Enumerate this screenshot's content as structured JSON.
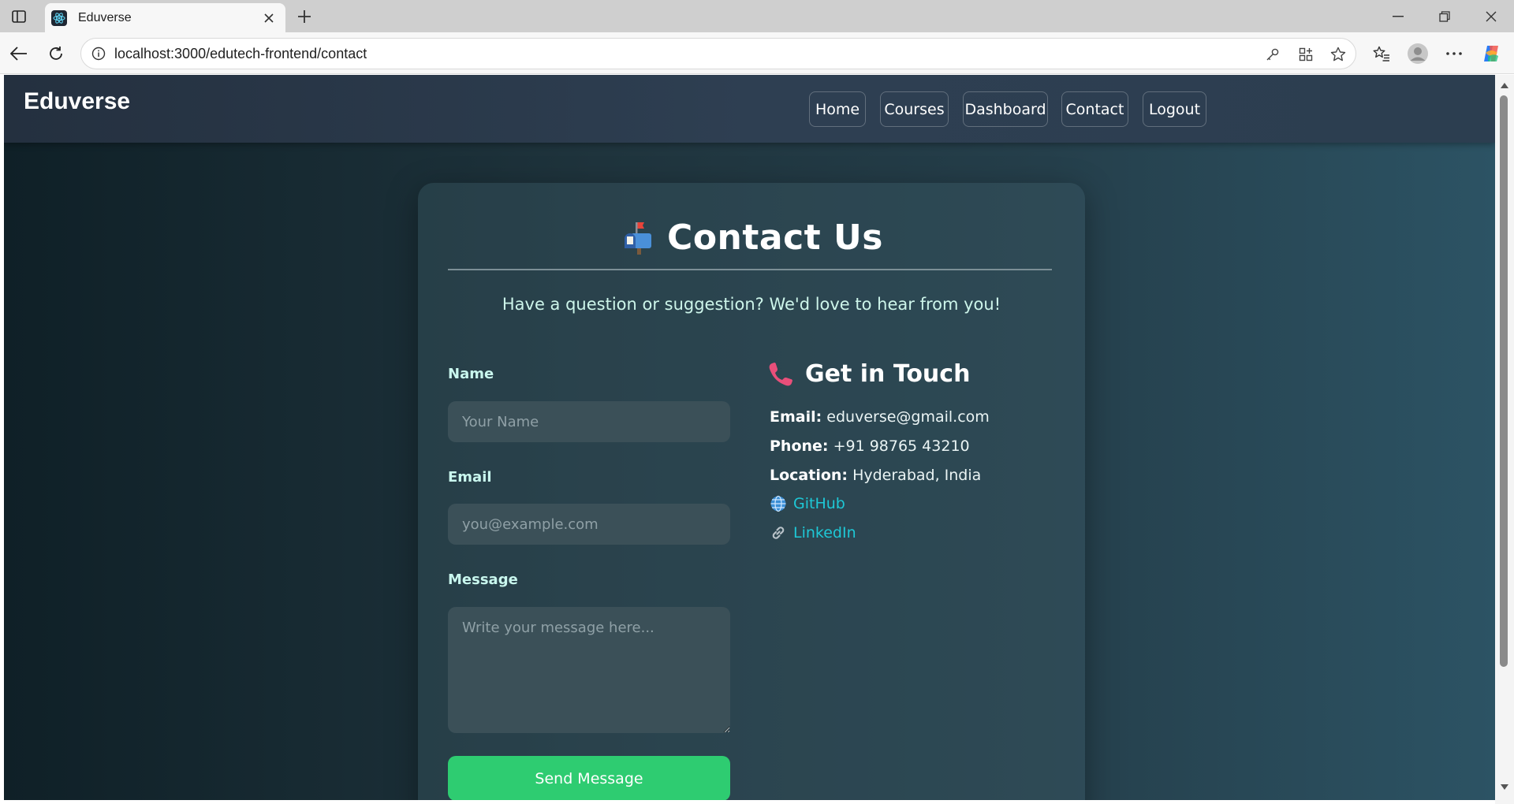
{
  "browser": {
    "tab_title": "Eduverse",
    "url": "localhost:3000/edutech-frontend/contact"
  },
  "site": {
    "brand": "Eduverse",
    "nav": [
      "Home",
      "Courses",
      "Dashboard",
      "Contact",
      "Logout"
    ]
  },
  "contact": {
    "title": "Contact Us",
    "subtitle": "Have a question or suggestion? We'd love to hear from you!",
    "form": {
      "name_label": "Name",
      "name_placeholder": "Your Name",
      "email_label": "Email",
      "email_placeholder": "you@example.com",
      "message_label": "Message",
      "message_placeholder": "Write your message here...",
      "submit_label": "Send Message"
    },
    "get_in_touch": {
      "heading": "Get in Touch",
      "email_label": "Email:",
      "email_value": "eduverse@gmail.com",
      "phone_label": "Phone:",
      "phone_value": "+91 98765 43210",
      "location_label": "Location:",
      "location_value": "Hyderabad, India",
      "github_label": "GitHub",
      "linkedin_label": "LinkedIn"
    }
  },
  "colors": {
    "accent_green": "#2ecc71",
    "link_cyan": "#1ec8d6",
    "label_mint": "#c9f7ee"
  }
}
